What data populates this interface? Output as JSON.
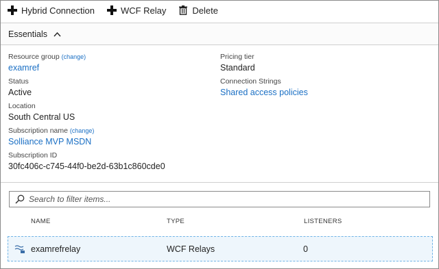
{
  "toolbar": {
    "hybrid_connection_label": "Hybrid Connection",
    "wcf_relay_label": "WCF Relay",
    "delete_label": "Delete"
  },
  "essentials": {
    "title": "Essentials",
    "expanded": true
  },
  "properties": {
    "resource_group_label": "Resource group",
    "resource_group_change": "(change)",
    "resource_group_value": "examref",
    "status_label": "Status",
    "status_value": "Active",
    "location_label": "Location",
    "location_value": "South Central US",
    "subscription_name_label": "Subscription name",
    "subscription_name_change": "(change)",
    "subscription_name_value": "Solliance MVP MSDN",
    "subscription_id_label": "Subscription ID",
    "subscription_id_value": "30fc406c-c745-44f0-be2d-63b1c860cde0",
    "pricing_tier_label": "Pricing tier",
    "pricing_tier_value": "Standard",
    "connection_strings_label": "Connection Strings",
    "connection_strings_value": "Shared access policies"
  },
  "search": {
    "placeholder": "Search to filter items..."
  },
  "table": {
    "columns": [
      "NAME",
      "TYPE",
      "LISTENERS"
    ],
    "rows": [
      {
        "name": "examrefrelay",
        "type": "WCF Relays",
        "listeners": "0"
      }
    ]
  },
  "colors": {
    "link": "#1a6fc4",
    "row_highlight": "#eef6fc",
    "row_border": "#6fb3e6"
  }
}
